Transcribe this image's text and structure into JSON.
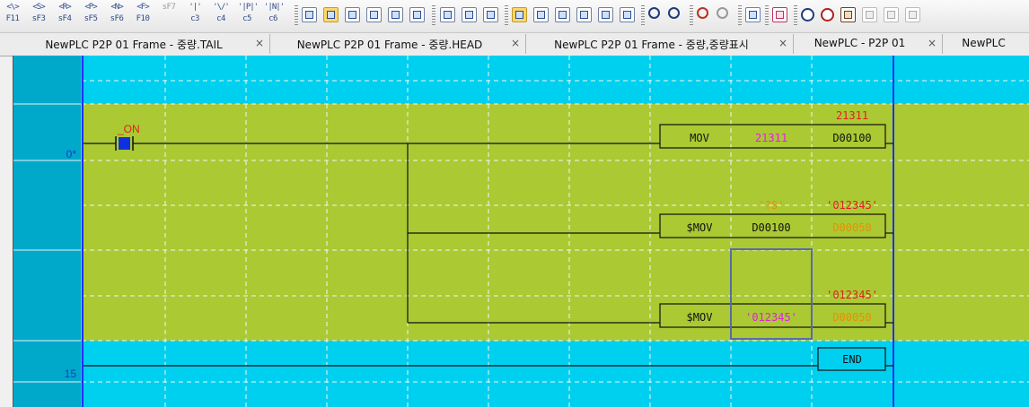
{
  "toolbar": {
    "function_keys": [
      {
        "symbol": "<\\>",
        "key": "F11"
      },
      {
        "symbol": "<S>",
        "key": "sF3"
      },
      {
        "symbol": "<R>",
        "key": "sF4"
      },
      {
        "symbol": "<P>",
        "key": "sF5"
      },
      {
        "symbol": "<N>",
        "key": "sF6"
      },
      {
        "symbol": "<F>",
        "key": "F10"
      },
      {
        "symbol": "",
        "key": "sF7"
      },
      {
        "symbol": "'|'",
        "key": "c3"
      },
      {
        "symbol": "'\\/'",
        "key": "c4"
      },
      {
        "symbol": "'|P|'",
        "key": "c5"
      },
      {
        "symbol": "'|N|'",
        "key": "c6"
      }
    ]
  },
  "tabs": [
    {
      "label": "NewPLC P2P 01 Frame - 중량.TAIL",
      "close": "×"
    },
    {
      "label": "NewPLC P2P 01 Frame - 중량.HEAD",
      "close": "×"
    },
    {
      "label": "NewPLC P2P 01 Frame - 중량,중량표시",
      "close": "×"
    },
    {
      "label": "NewPLC - P2P 01",
      "close": "×"
    },
    {
      "label": "NewPLC",
      "close": "x"
    }
  ],
  "ladder": {
    "colors": {
      "background": "#00d0ef",
      "rung_fill": "#abc933",
      "wire": "#111111",
      "contact_active": "#1030e0",
      "device_red": "#e02020",
      "device_magenta": "#e020e0",
      "device_orange": "#e89000",
      "rail": "#2030ff",
      "step_number": "#1a3cc8"
    },
    "step_numbers": [
      {
        "label": "0*"
      },
      {
        "label": "15"
      }
    ],
    "contact": {
      "name": "_ON"
    },
    "instructions": [
      {
        "mnemonic": "MOV",
        "operands": [
          {
            "text": "21311",
            "color": "magenta"
          },
          {
            "text": "D00100",
            "color": "black"
          }
        ],
        "monitor": [
          {
            "text": "",
            "color": "red"
          },
          {
            "text": "21311",
            "color": "red"
          }
        ]
      },
      {
        "mnemonic": "$MOV",
        "operands": [
          {
            "text": "D00100",
            "color": "black"
          },
          {
            "text": "D00050",
            "color": "orange"
          }
        ],
        "monitor": [
          {
            "text": "'?S'",
            "color": "orange"
          },
          {
            "text": "'012345'",
            "color": "red"
          }
        ]
      },
      {
        "mnemonic": "$MOV",
        "operands": [
          {
            "text": "'012345'",
            "color": "magenta"
          },
          {
            "text": "D00050",
            "color": "orange"
          }
        ],
        "monitor": [
          {
            "text": "",
            "color": "red"
          },
          {
            "text": "'012345'",
            "color": "red"
          }
        ]
      }
    ],
    "end_instruction": {
      "mnemonic": "END"
    }
  }
}
